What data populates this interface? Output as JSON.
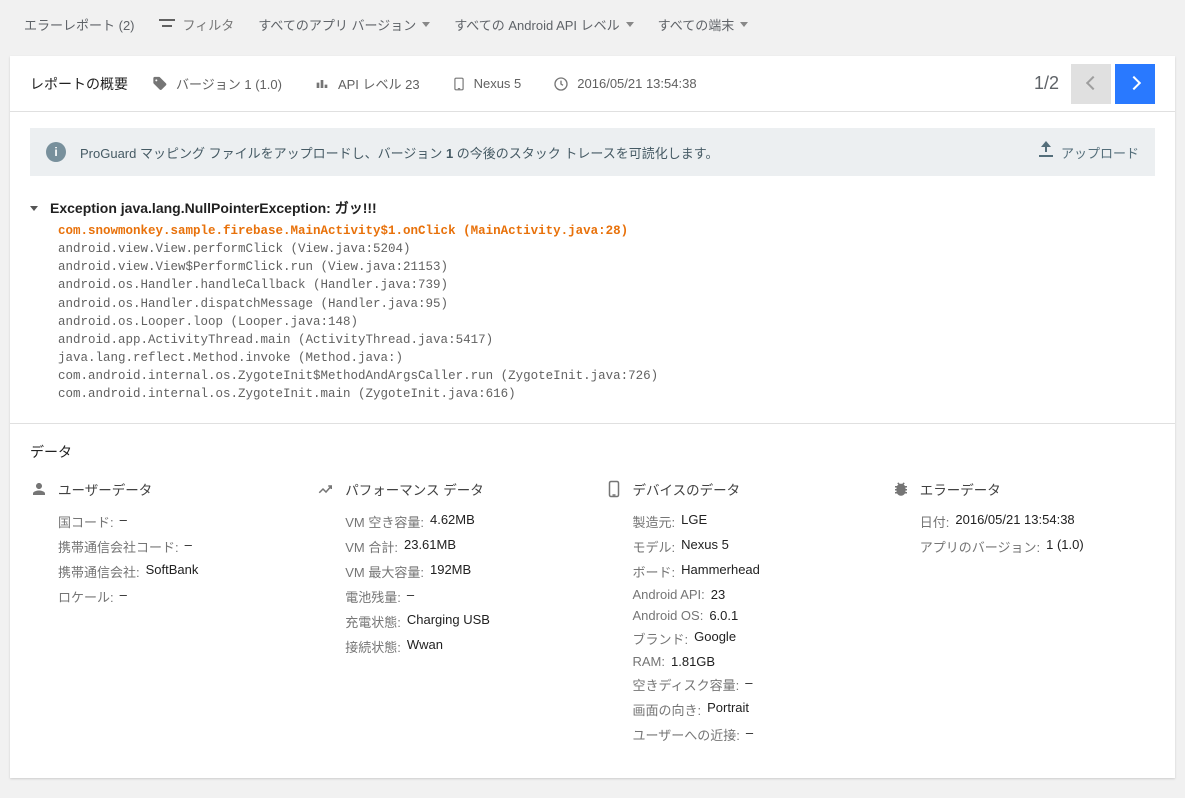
{
  "topbar": {
    "title": "エラーレポート (2)",
    "filter_label": "フィルタ",
    "app_version_dd": "すべてのアプリ バージョン",
    "api_level_dd": "すべての Android API レベル",
    "device_dd": "すべての端末"
  },
  "summary": {
    "title": "レポートの概要",
    "version_label": "バージョン 1 (1.0)",
    "api_label": "API レベル 23",
    "device_label": "Nexus 5",
    "timestamp": "2016/05/21 13:54:38",
    "pager": "1/2"
  },
  "banner": {
    "text_before": "ProGuard マッピング ファイルをアップロードし、バージョン ",
    "bold": "1",
    "text_after": " の今後のスタック トレースを可読化します。",
    "upload_label": "アップロード"
  },
  "stack": {
    "title": "Exception java.lang.NullPointerException: ガッ!!!",
    "highlight": "com.snowmonkey.sample.firebase.MainActivity$1.onClick (MainActivity.java:28)",
    "lines": [
      "android.view.View.performClick (View.java:5204)",
      "android.view.View$PerformClick.run (View.java:21153)",
      "android.os.Handler.handleCallback (Handler.java:739)",
      "android.os.Handler.dispatchMessage (Handler.java:95)",
      "android.os.Looper.loop (Looper.java:148)",
      "android.app.ActivityThread.main (ActivityThread.java:5417)",
      "java.lang.reflect.Method.invoke (Method.java:)",
      "com.android.internal.os.ZygoteInit$MethodAndArgsCaller.run (ZygoteInit.java:726)",
      "com.android.internal.os.ZygoteInit.main (ZygoteInit.java:616)"
    ]
  },
  "data": {
    "section_title": "データ",
    "user": {
      "title": "ユーザーデータ",
      "rows": [
        {
          "k": "国コード:",
          "v": "–"
        },
        {
          "k": "携帯通信会社コード:",
          "v": "–"
        },
        {
          "k": "携帯通信会社:",
          "v": "SoftBank"
        },
        {
          "k": "ロケール:",
          "v": "–"
        }
      ]
    },
    "perf": {
      "title": "パフォーマンス データ",
      "rows": [
        {
          "k": "VM 空き容量:",
          "v": "4.62MB"
        },
        {
          "k": "VM 合計:",
          "v": "23.61MB"
        },
        {
          "k": "VM 最大容量:",
          "v": "192MB"
        },
        {
          "k": "電池残量:",
          "v": "–"
        },
        {
          "k": "充電状態:",
          "v": "Charging USB"
        },
        {
          "k": "接続状態:",
          "v": "Wwan"
        }
      ]
    },
    "device": {
      "title": "デバイスのデータ",
      "rows": [
        {
          "k": "製造元:",
          "v": "LGE"
        },
        {
          "k": "モデル:",
          "v": "Nexus 5"
        },
        {
          "k": "ボード:",
          "v": "Hammerhead"
        },
        {
          "k": "Android API:",
          "v": "23"
        },
        {
          "k": "Android OS:",
          "v": "6.0.1"
        },
        {
          "k": "ブランド:",
          "v": "Google"
        },
        {
          "k": "RAM:",
          "v": "1.81GB"
        },
        {
          "k": "空きディスク容量:",
          "v": "–"
        },
        {
          "k": "画面の向き:",
          "v": "Portrait"
        },
        {
          "k": "ユーザーへの近接:",
          "v": "–"
        }
      ]
    },
    "error": {
      "title": "エラーデータ",
      "rows": [
        {
          "k": "日付:",
          "v": "2016/05/21 13:54:38"
        },
        {
          "k": "アプリのバージョン:",
          "v": "1 (1.0)"
        }
      ]
    }
  }
}
